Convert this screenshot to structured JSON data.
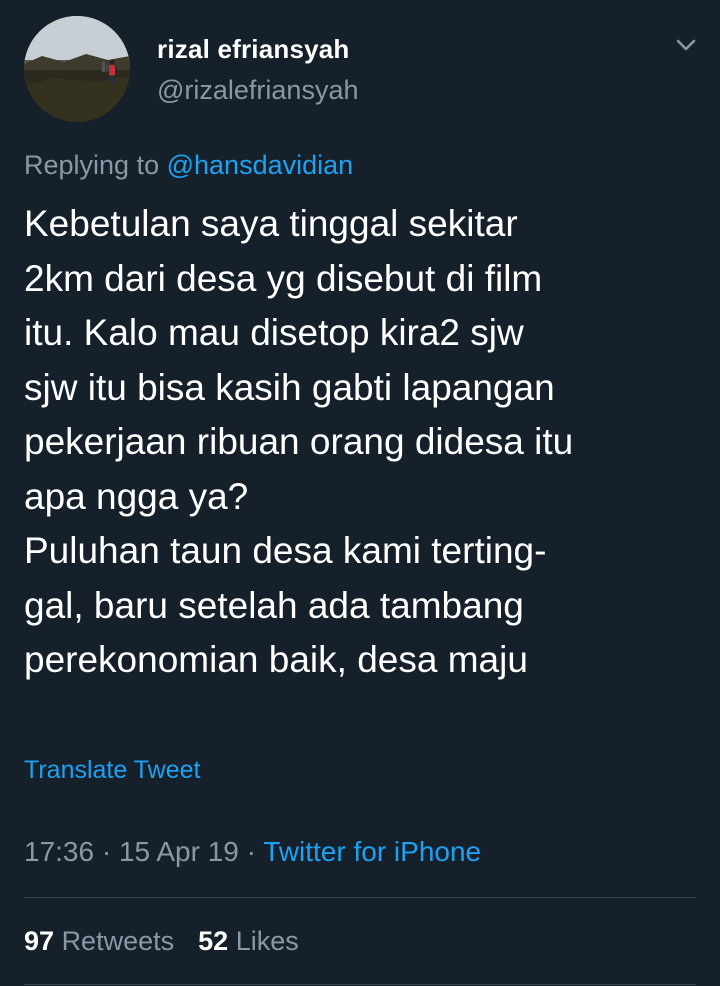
{
  "tweet": {
    "author": {
      "display_name": "rizal efriansyah",
      "handle": "@rizalefriansyah"
    },
    "replying_label": "Replying to",
    "replying_to": "@hansdavidian",
    "text_lines": [
      "Kebetulan saya tinggal sekitar",
      "2km dari desa yg disebut di film",
      "itu. Kalo mau disetop kira2 sjw",
      "sjw itu bisa kasih gabti lapangan",
      "pekerjaan ribuan orang didesa itu",
      "apa ngga ya?",
      "Puluhan taun desa kami terting-",
      "gal, baru setelah ada tambang",
      "perekonomian baik, desa maju"
    ],
    "translate_label": "Translate Tweet",
    "time": "17:36",
    "separator": "·",
    "date": "15 Apr 19",
    "source": "Twitter for iPhone",
    "retweets_count": "97",
    "retweets_label": "Retweets",
    "likes_count": "52",
    "likes_label": "Likes"
  },
  "icons": {
    "menu": "chevron-down-icon"
  },
  "colors": {
    "background": "#15202b",
    "primary_text": "#ffffff",
    "secondary_text": "#8899a6",
    "accent": "#1da1f2",
    "divider": "#38444d"
  }
}
